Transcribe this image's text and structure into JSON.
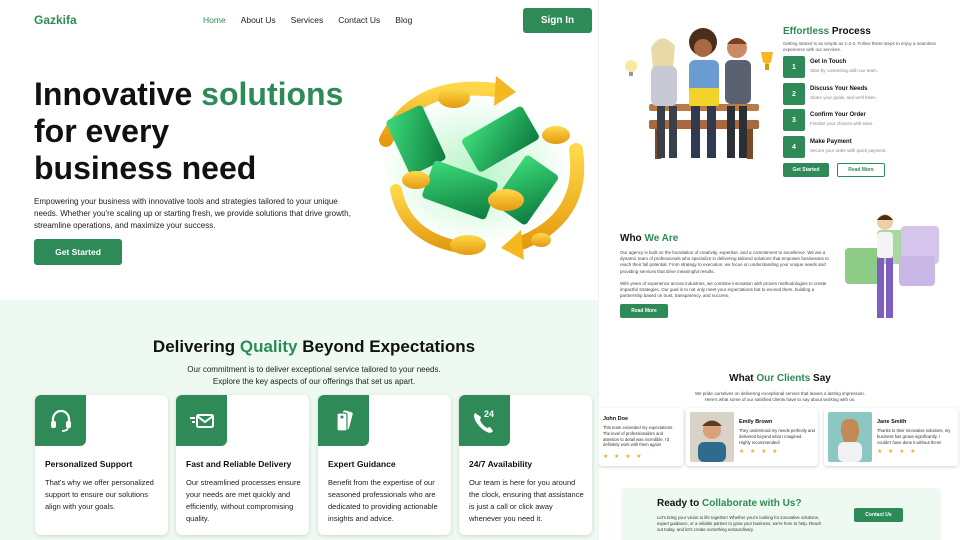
{
  "nav": {
    "logo": "Gazkifa",
    "items": [
      "Home",
      "About Us",
      "Services",
      "Contact Us",
      "Blog"
    ],
    "active_item": "Home",
    "signin_label": "Sign In"
  },
  "hero": {
    "title_line1_a": "Innovative ",
    "title_line1_b": "solutions",
    "title_line2": "for every",
    "title_line3": "business need",
    "description": "Empowering your business with innovative tools and strategies tailored to your unique needs. Whether you're scaling up or starting fresh, we provide solutions that drive growth, streamline operations, and maximize your success.",
    "cta_label": "Get Started"
  },
  "quality": {
    "title_a": "Delivering ",
    "title_b": "Quality",
    "title_c": " Beyond Expectations",
    "desc_line1": "Our commitment is to deliver exceptional service tailored to your needs.",
    "desc_line2": "Explore the key aspects of our offerings that set us apart.",
    "cards": [
      {
        "icon": "headset-icon",
        "title": "Personalized Support",
        "text": "That's why we offer personalized support to ensure our solutions align with your goals."
      },
      {
        "icon": "fast-mail-icon",
        "title": "Fast and Reliable Delivery",
        "text": "Our streamlined processes ensure your needs are met quickly and efficiently, without compromising quality."
      },
      {
        "icon": "tag-icon",
        "title": "Expert Guidance",
        "text": "Benefit from the expertise of our seasoned professionals who are dedicated to providing actionable insights and advice."
      },
      {
        "icon": "phone-24-icon",
        "title": "24/7 Availability",
        "text": "Our team is here for you around the clock, ensuring that assistance is just a call or click away whenever you need it."
      }
    ]
  },
  "process": {
    "title_a": "Effortless",
    "title_b": " Process",
    "description": "Getting started is as simple as 1-2-3. Follow these steps to enjoy a seamless experience with our services.",
    "steps": [
      {
        "num": "1",
        "title": "Get in Touch",
        "text": "Start by connecting with our team."
      },
      {
        "num": "2",
        "title": "Discuss Your Needs",
        "text": "Share your goals, and we'll listen."
      },
      {
        "num": "3",
        "title": "Confirm Your Order",
        "text": "Finalize your choices with ease."
      },
      {
        "num": "4",
        "title": "Make Payment",
        "text": "Secure your order with quick payment."
      }
    ],
    "btn_primary": "Get Started",
    "btn_secondary": "Read More"
  },
  "about": {
    "title_a": "Who ",
    "title_b": "We Are",
    "p1": "Our agency is built on the foundation of creativity, expertise, and a commitment to excellence. We are a dynamic team of professionals who specialize in delivering tailored solutions that empower businesses to reach their full potential. From strategy to execution, we focus on understanding your unique needs and providing services that drive meaningful results.",
    "p2": "With years of experience across industries, we combine innovation with proven methodologies to create impactful strategies. Our goal is to not only meet your expectations but to exceed them, building a partnership based on trust, transparency, and success.",
    "btn": "Read More"
  },
  "clients": {
    "title_a": "What ",
    "title_b": "Our Clients",
    "title_c": " Say",
    "desc_line1": "We pride ourselves on delivering exceptional service that leaves a lasting impression.",
    "desc_line2": "Here's what some of our satisfied clients have to say about working with us.",
    "stars": "★ ★ ★ ★",
    "testimonials": [
      {
        "name": "John Doe",
        "text": "This team exceeded my expectations. The level of professionalism and attention to detail was incredible. I'd definitely work with them again!"
      },
      {
        "name": "Emily Brown",
        "text": "They understood my needs perfectly and delivered beyond what I imagined. Highly recommended!"
      },
      {
        "name": "Jane Smith",
        "text": "Thanks to their innovative solutions, my business has grown significantly. I couldn't have done it without them!"
      }
    ]
  },
  "cta": {
    "title_a": "Ready to ",
    "title_b": "Collaborate with Us?",
    "description": "Let's bring your vision to life together! Whether you're looking for innovative solutions, expert guidance, or a reliable partner to grow your business, we're here to help. Reach out today, and let's create something extraordinary.",
    "btn": "Contact Us"
  },
  "colors": {
    "accent": "#2e8b57",
    "section_bg": "#eefaf1",
    "star": "#f2b01e"
  }
}
